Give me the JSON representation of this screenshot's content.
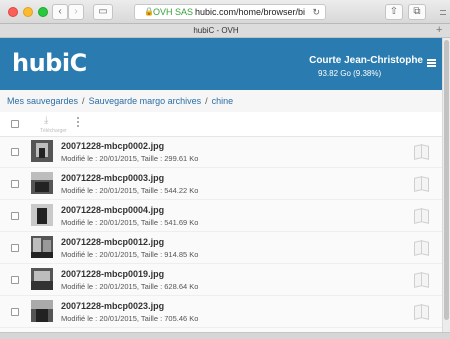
{
  "browser": {
    "back_glyph": "‹",
    "forward_glyph": "›",
    "sidebar_glyph": "▭",
    "share_glyph": "⇧",
    "tabs_glyph": "⧉",
    "lock_glyph": "🔒",
    "org_name": "OVH SAS",
    "url": "hubic.com/home/browser/bi",
    "reload_glyph": "↻",
    "tab_title": "hubiC - OVH",
    "new_tab_glyph": "+"
  },
  "header": {
    "logo": "hubiC",
    "user_name": "Courte Jean-Christophe",
    "quota": "93.82 Go (9.38%)",
    "accent_color": "#2a7cb0"
  },
  "breadcrumb": {
    "items": [
      "Mes sauvegardes",
      "Sauvegarde margo archives",
      "chine"
    ],
    "separator": "/"
  },
  "actions": {
    "download_glyph": "⤓",
    "download_label": "Télécharger"
  },
  "files": [
    {
      "name": "20071228-mbcp0002.jpg",
      "meta": "Modifié le : 20/01/2015, Taille : 299.61 Ko"
    },
    {
      "name": "20071228-mbcp0003.jpg",
      "meta": "Modifié le : 20/01/2015, Taille : 544.22 Ko"
    },
    {
      "name": "20071228-mbcp0004.jpg",
      "meta": "Modifié le : 20/01/2015, Taille : 541.69 Ko"
    },
    {
      "name": "20071228-mbcp0012.jpg",
      "meta": "Modifié le : 20/01/2015, Taille : 914.85 Ko"
    },
    {
      "name": "20071228-mbcp0019.jpg",
      "meta": "Modifié le : 20/01/2015, Taille : 628.64 Ko"
    },
    {
      "name": "20071228-mbcp0023.jpg",
      "meta": "Modifié le : 20/01/2015, Taille : 705.46 Ko"
    }
  ]
}
